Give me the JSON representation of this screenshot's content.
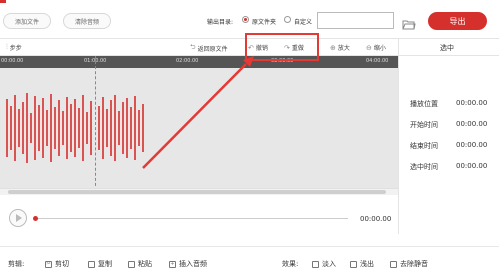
{
  "topbar": {
    "add_file": "添加文件",
    "clear_audio": "清除音频",
    "output_dir_label": "输出目录:",
    "radio_source": "原文件夹",
    "radio_custom": "自定义",
    "path_value": "",
    "export_label": "导出"
  },
  "toolbar": {
    "step": "步步",
    "return_source": "返回原文件",
    "undo": "撤销",
    "redo": "重做",
    "zoom_in": "放大",
    "zoom_out": "缩小"
  },
  "ruler": {
    "ticks": [
      "00:00.00",
      "01:00.00",
      "02:00.00",
      "03:00.00",
      "04:00.00"
    ]
  },
  "panel": {
    "title": "选中",
    "rows": [
      {
        "label": "播放位置",
        "value": "00:00.00"
      },
      {
        "label": "开始时间",
        "value": "00:00.00"
      },
      {
        "label": "结束时间",
        "value": "00:00.00"
      },
      {
        "label": "选中时间",
        "value": "00:00.00"
      }
    ]
  },
  "playback": {
    "time": "00:00.00",
    "progress": 0
  },
  "bottom": {
    "edit_label": "剪辑:",
    "cut": "剪切",
    "copy": "复制",
    "paste": "粘贴",
    "insert_audio": "插入音频",
    "effects_label": "效果:",
    "fade_in": "淡入",
    "fade_out": "浅出",
    "remove_silence": "去除静音"
  },
  "colors": {
    "accent": "#d6302c",
    "waveform": "#d6302c",
    "annotation": "#e53935"
  }
}
